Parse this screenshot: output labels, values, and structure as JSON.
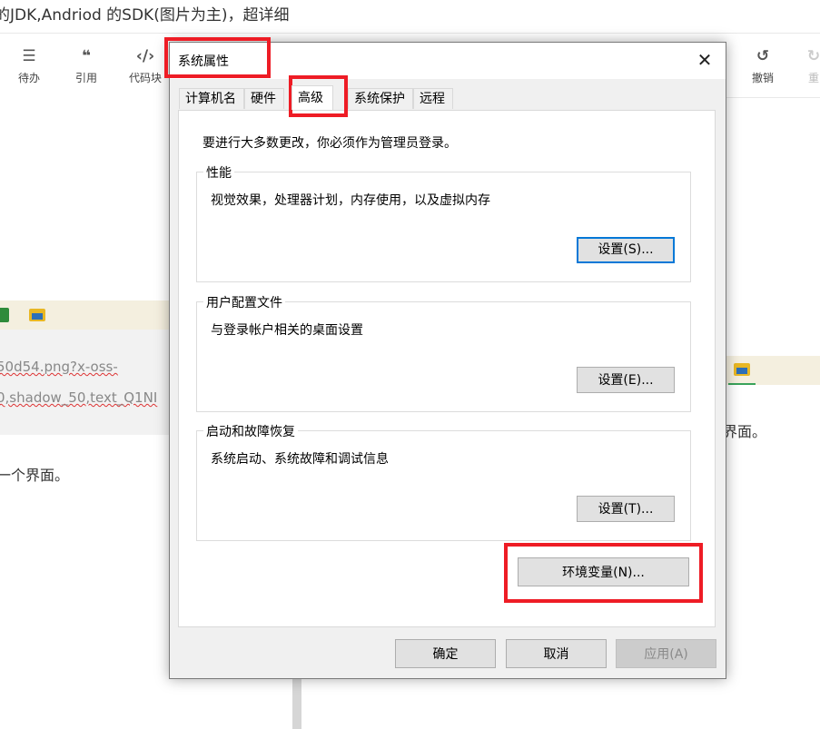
{
  "background": {
    "page_title": "的JDK,Andriod 的SDK(图片为主)，超详细",
    "toolbar": {
      "left_items": [
        {
          "label": "待办",
          "icon": "checklist-icon",
          "glyph": "☰"
        },
        {
          "label": "引用",
          "icon": "quote-icon",
          "glyph": "❝"
        },
        {
          "label": "代码块",
          "icon": "code-icon",
          "glyph": "‹/›"
        }
      ],
      "right_items": [
        {
          "label": "撤销",
          "icon": "undo-icon",
          "glyph": "↺"
        },
        {
          "label": "重",
          "icon": "redo-icon",
          "glyph": "↻"
        }
      ]
    },
    "editor": {
      "url_line1": "50d54.png?x-oss-",
      "url_line2": "0,shadow_50,text_Q1NI",
      "left_text": "一个界面。",
      "right_text": "界面。"
    }
  },
  "dialog": {
    "title": "系统属性",
    "close_glyph": "✕",
    "tabs": [
      {
        "label": "计算机名",
        "active": false
      },
      {
        "label": "硬件",
        "active": false
      },
      {
        "label": "高级",
        "active": true
      },
      {
        "label": "系统保护",
        "active": false
      },
      {
        "label": "远程",
        "active": false
      }
    ],
    "admin_note": "要进行大多数更改，你必须作为管理员登录。",
    "groups": {
      "performance": {
        "legend": "性能",
        "description": "视觉效果，处理器计划，内存使用，以及虚拟内存",
        "button": "设置(S)...",
        "mnemonic": "S"
      },
      "user_profiles": {
        "legend": "用户配置文件",
        "description": "与登录帐户相关的桌面设置",
        "button": "设置(E)...",
        "mnemonic": "E"
      },
      "startup_recovery": {
        "legend": "启动和故障恢复",
        "description": "系统启动、系统故障和调试信息",
        "button": "设置(T)...",
        "mnemonic": "T"
      }
    },
    "env_button": "环境变量(N)...",
    "footer": {
      "ok": "确定",
      "cancel": "取消",
      "apply": "应用(A)"
    }
  },
  "colors": {
    "annotation_red": "#ee1c25",
    "focus_blue": "#0078d7",
    "dialog_bg": "#f0f0f0",
    "button_bg": "#e1e1e1"
  }
}
